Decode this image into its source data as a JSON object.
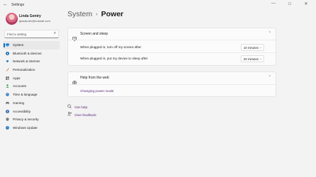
{
  "window": {
    "title": "Settings",
    "back_glyph": "←",
    "minimize_glyph": "—",
    "maximize_glyph": "☐",
    "close_glyph": "✕"
  },
  "user": {
    "name": "Linda Gentry",
    "email": "glasskuter@hotmail.com"
  },
  "search": {
    "placeholder": "Find a setting",
    "icon": "search-icon"
  },
  "nav": [
    {
      "label": "System",
      "icon": "monitor-icon",
      "color": "#0078d4",
      "active": true
    },
    {
      "label": "Bluetooth & devices",
      "icon": "bluetooth-icon",
      "color": "#0063b1"
    },
    {
      "label": "Network & internet",
      "icon": "wifi-icon",
      "color": "#2d7cc1"
    },
    {
      "label": "Personalization",
      "icon": "brush-icon",
      "color": "#c2632a"
    },
    {
      "label": "Apps",
      "icon": "apps-icon",
      "color": "#5a5a5a"
    },
    {
      "label": "Accounts",
      "icon": "person-icon",
      "color": "#1f9d55"
    },
    {
      "label": "Time & language",
      "icon": "globe-clock-icon",
      "color": "#2b79c2"
    },
    {
      "label": "Gaming",
      "icon": "gamepad-icon",
      "color": "#6b6b6b"
    },
    {
      "label": "Accessibility",
      "icon": "accessibility-icon",
      "color": "#1b5fa8"
    },
    {
      "label": "Privacy & security",
      "icon": "shield-icon",
      "color": "#7a7a7a"
    },
    {
      "label": "Windows Update",
      "icon": "update-icon",
      "color": "#0a6fc2"
    }
  ],
  "breadcrumb": {
    "parent": "System",
    "separator": "›",
    "current": "Power"
  },
  "screen_sleep": {
    "title": "Screen and sleep",
    "icon": "screen-sleep-icon",
    "rows": [
      {
        "label": "When plugged in, turn off my screen after",
        "value": "10 minutes"
      },
      {
        "label": "When plugged in, put my device to sleep after",
        "value": "20 minutes"
      }
    ]
  },
  "help_web": {
    "title": "Help from the web",
    "icon": "help-globe-icon",
    "link": "Changing power mode"
  },
  "footer_links": {
    "get_help": "Get help",
    "give_feedback": "Give feedback"
  }
}
